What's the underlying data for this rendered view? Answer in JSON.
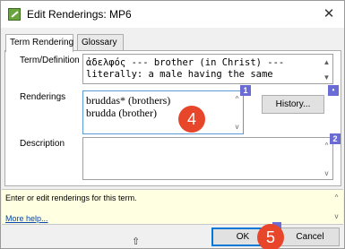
{
  "window": {
    "title": "Edit Renderings: MP6",
    "close_glyph": "✕"
  },
  "tabs": [
    {
      "label": "Term Rendering",
      "active": true
    },
    {
      "label": "Glossary",
      "active": false
    }
  ],
  "term_definition": {
    "label": "Term/Definition",
    "lines": [
      "ἀδελφός --- brother (in Christ) ---",
      "literally: a male having the same"
    ]
  },
  "renderings": {
    "label": "Renderings",
    "lines": [
      "bruddas* (brothers)",
      "brudda (brother)"
    ],
    "badge": "1"
  },
  "history_button": {
    "label": "History...",
    "badge": "•"
  },
  "description": {
    "label": "Description",
    "value": "",
    "badge": "2"
  },
  "help": {
    "text": "Enter or edit renderings for this term.",
    "link": "More help..."
  },
  "buttons": {
    "ok": "OK",
    "cancel": "Cancel"
  },
  "callouts": {
    "step4": "4",
    "step5": "5"
  },
  "colors": {
    "badge": "#6b6bd6",
    "callout": "#e8462a",
    "help_bg": "#ffffe1"
  }
}
